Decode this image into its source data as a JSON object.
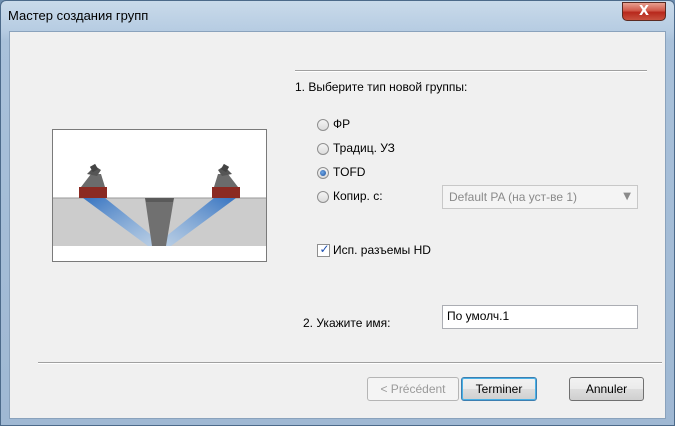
{
  "window": {
    "title": "Мастер создания групп",
    "close_label": "X"
  },
  "step1": {
    "heading": "1. Выберите тип новой группы:",
    "options": [
      {
        "label": "ФР",
        "checked": false
      },
      {
        "label": "Традиц. УЗ",
        "checked": false
      },
      {
        "label": "TOFD",
        "checked": true
      },
      {
        "label": "Копир. с:",
        "checked": false
      }
    ],
    "copy_from_value": "Default PA (на уст-ве 1)",
    "hd_checkbox_label": "Исп. разъемы HD",
    "hd_checked": true
  },
  "step2": {
    "label": "2. Укажите имя:",
    "name_value": "По умолч.1"
  },
  "buttons": {
    "previous": "< Précédent",
    "finish": "Terminer",
    "cancel": "Annuler"
  },
  "colors": {
    "beam": "#4a8fd0",
    "plate": "#cccccc",
    "probe": "#8b2a22"
  }
}
